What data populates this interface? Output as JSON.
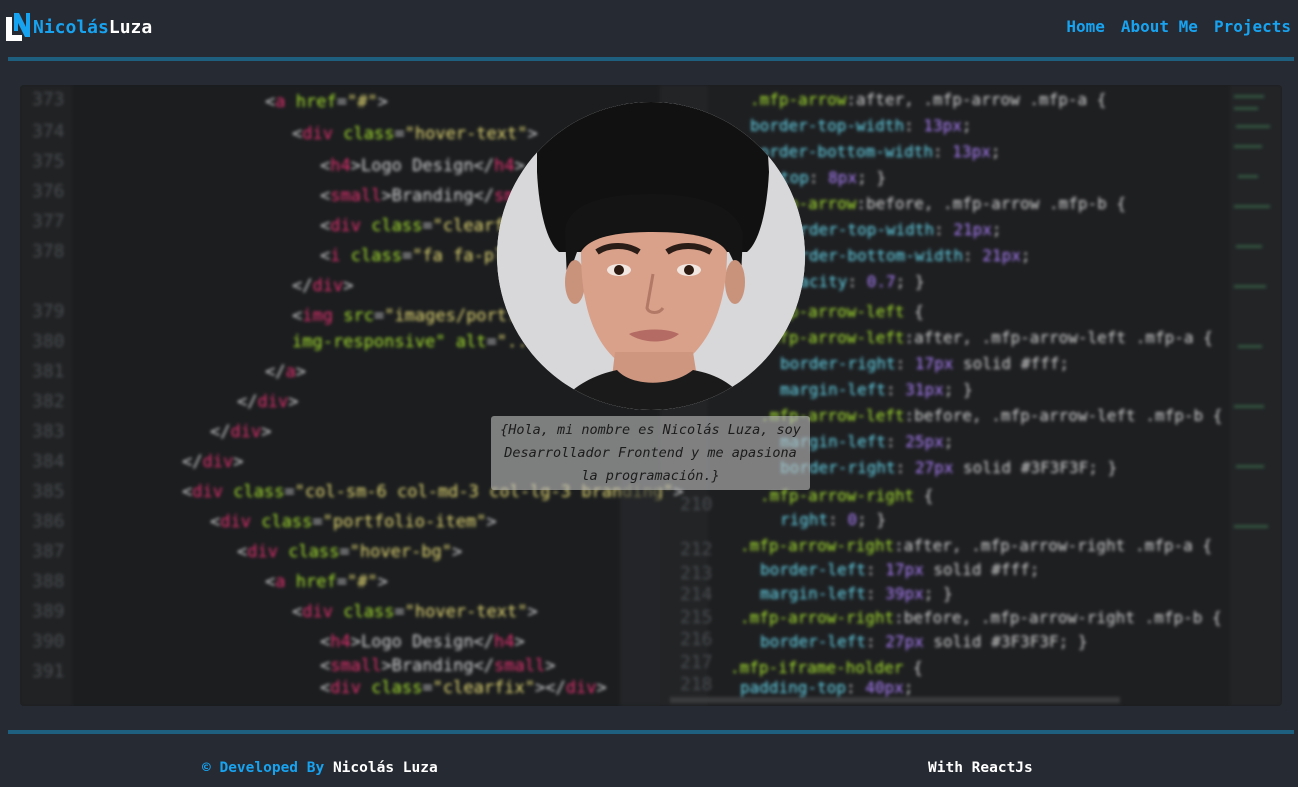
{
  "brand": {
    "first": "Nicolás",
    "last": "Luza",
    "accent": "#18a3f0"
  },
  "nav": {
    "items": [
      "Home",
      "About Me",
      "Projects"
    ]
  },
  "hero": {
    "intro_text": "{Hola, mi nombre es Nicolás Luza, soy Desarrollador Frontend y me apasiona la programación.}"
  },
  "footer": {
    "prefix": "© Developed By",
    "name": "Nicolás Luza",
    "tech": "With ReactJs"
  },
  "colors": {
    "background": "#262a33",
    "rule": "#1e5f80",
    "link": "#18a3f0"
  }
}
